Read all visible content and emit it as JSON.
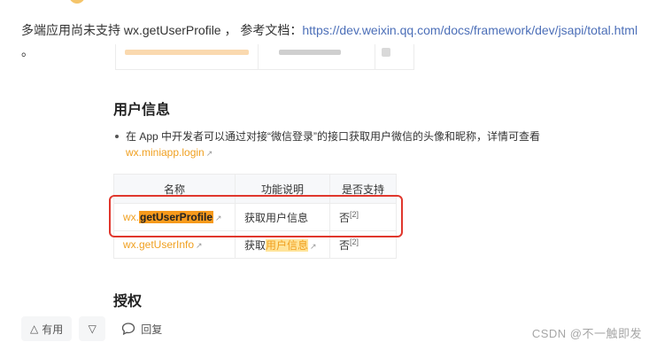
{
  "intro": {
    "text": "多端应用尚未支持 wx.getUserProfile ， 参考文档：",
    "link": "https://dev.weixin.qq.com/docs/framework/dev/jsapi/total.html",
    "trailing": " 。"
  },
  "doc": {
    "section_title": "用户信息",
    "bullet_text": "在 App 中开发者可以通过对接“微信登录”的接口获取用户微信的头像和昵称，详情可查看",
    "login_link": "wx.miniapp.login",
    "table": {
      "headers": [
        "名称",
        "功能说明",
        "是否支持"
      ],
      "rows": [
        {
          "api_prefix": "wx.",
          "api_highlight": "getUserProfile",
          "desc": "获取用户信息",
          "support": "否",
          "note": "[2]"
        },
        {
          "api_full": "wx.getUserInfo",
          "desc_prefix": "获取",
          "desc_highlight": "用户信息",
          "support": "否",
          "note": "[2]"
        }
      ]
    },
    "section_title_2": "授权"
  },
  "actions": {
    "useful_label": "有用",
    "reply_label": "回复"
  },
  "watermark": "CSDN @不一触即发",
  "colors": {
    "link": "#4c6fb8",
    "api_orange": "#f0a020",
    "highlight": "#f79a1c",
    "frame": "#e0372d"
  }
}
